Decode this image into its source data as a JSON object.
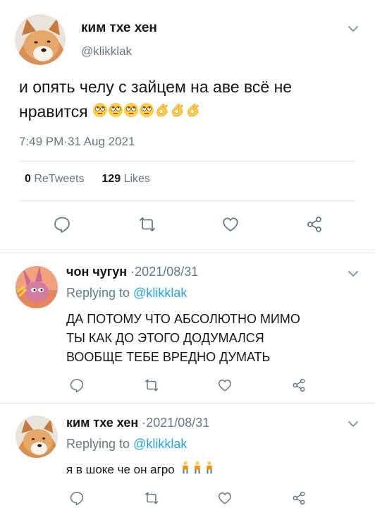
{
  "main_tweet": {
    "name": "ким тхе хен",
    "handle": "@klikklak",
    "text": "и опять челу с зайцем на аве всё не нравится",
    "emojis": [
      "face-with-rolling-eyes",
      "face-with-rolling-eyes",
      "face-with-rolling-eyes",
      "face-with-rolling-eyes",
      "ok-hand",
      "ok-hand",
      "ok-hand"
    ],
    "timestamp": "7:49 PM·31 Aug 2021",
    "retweets_count": "0",
    "retweets_label": "ReTweets",
    "likes_count": "129",
    "likes_label": "Likes"
  },
  "replies": [
    {
      "name": "чон чугун",
      "date": " ·2021/08/31",
      "replying_prefix": "Replying to ",
      "replying_handle": "@klikklak",
      "text_lines": [
        "ДА ПОТОМУ ЧТО АБСОЛЮТНО МИМО",
        "ТЫ КАК ДО ЭТОГО ДОДУМАЛСЯ",
        "ВООБЩЕ ТЕБЕ ВРЕДНО ДУМАТЬ"
      ]
    },
    {
      "name": "ким тхе хен",
      "date": " ·2021/08/31",
      "replying_prefix": "Replying to ",
      "replying_handle": "@klikklak",
      "text": "я в шоке че он агро",
      "emojis": [
        "person-standing",
        "person-standing",
        "person-standing"
      ]
    }
  ],
  "icons": {
    "reply": "speech-bubble-icon",
    "retweet": "retweet-icon",
    "like": "heart-icon",
    "share": "share-icon",
    "menu": "chevron-down-icon"
  },
  "colors": {
    "link": "#1da1f2",
    "secondary": "#657786",
    "divider": "#e1e8ed"
  }
}
